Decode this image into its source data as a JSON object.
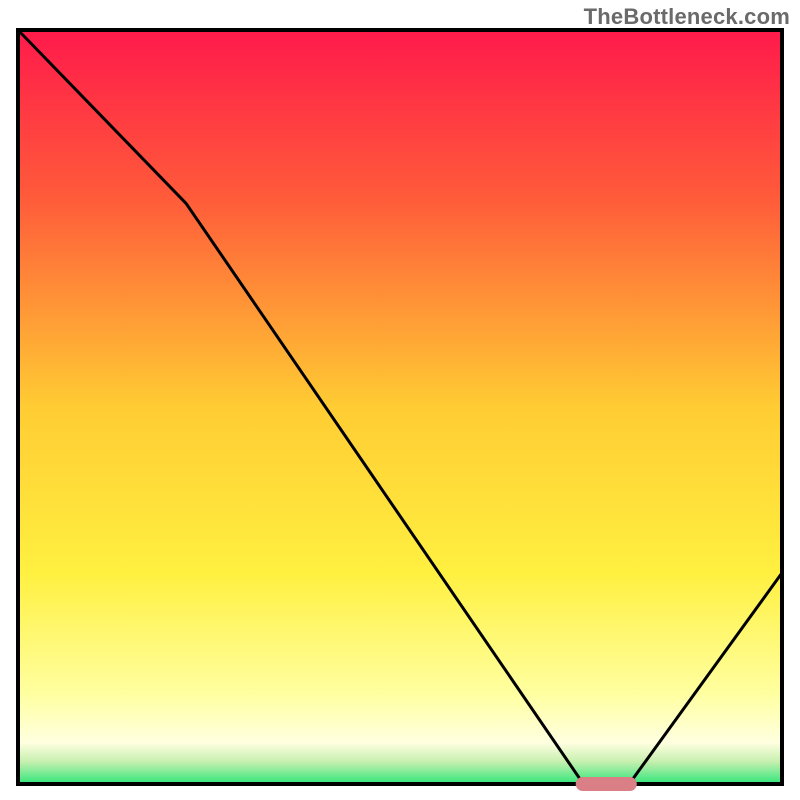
{
  "watermark": "TheBottleneck.com",
  "chart_data": {
    "type": "line",
    "title": "",
    "xlabel": "",
    "ylabel": "",
    "xlim": [
      0,
      100
    ],
    "ylim": [
      0,
      100
    ],
    "grid": false,
    "legend": false,
    "series": [
      {
        "name": "bottleneck-curve",
        "x": [
          0,
          22,
          74,
          80,
          100
        ],
        "y": [
          100,
          77,
          0,
          0,
          28
        ]
      }
    ],
    "marker": {
      "name": "optimal-range",
      "x_start": 73,
      "x_end": 81,
      "y": 0,
      "color": "#d97f85"
    },
    "background_gradient": {
      "stops": [
        {
          "offset": 0.0,
          "color": "#ff1a4b"
        },
        {
          "offset": 0.22,
          "color": "#ff5a3a"
        },
        {
          "offset": 0.5,
          "color": "#ffcc33"
        },
        {
          "offset": 0.72,
          "color": "#fff040"
        },
        {
          "offset": 0.88,
          "color": "#ffffa0"
        },
        {
          "offset": 0.945,
          "color": "#ffffe0"
        },
        {
          "offset": 0.97,
          "color": "#c8f0b0"
        },
        {
          "offset": 1.0,
          "color": "#2fe67a"
        }
      ]
    },
    "frame_color": "#000000",
    "line_color": "#000000",
    "line_width": 3
  }
}
